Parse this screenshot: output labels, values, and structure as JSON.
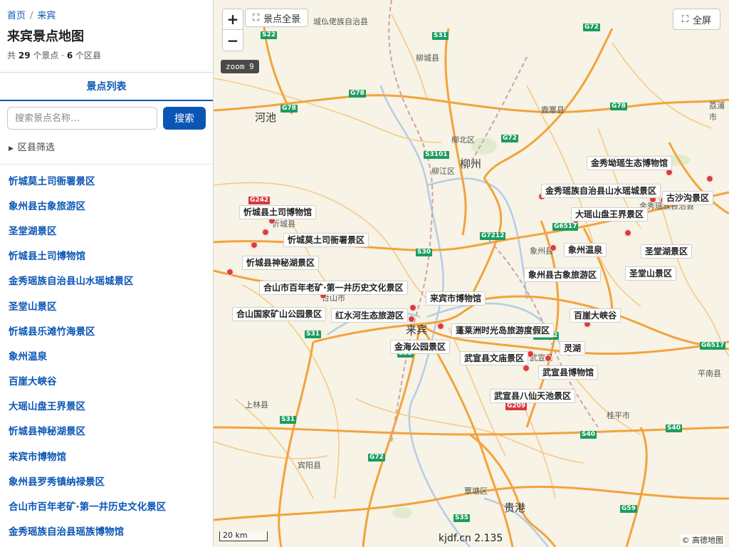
{
  "breadcrumb": {
    "home": "首页",
    "current": "来宾",
    "separator": "/"
  },
  "page": {
    "title": "来宾景点地图",
    "stats_prefix": "共",
    "spot_count": "29",
    "spot_unit": "个景点 ·",
    "district_count": "6",
    "district_unit": "个区县"
  },
  "tab": {
    "label": "景点列表"
  },
  "search": {
    "placeholder": "搜索景点名称…",
    "button": "搜索"
  },
  "filter": {
    "label": "区县筛选",
    "arrow": "▶"
  },
  "spots": [
    "忻城莫土司衙署景区",
    "象州县古象旅游区",
    "圣堂湖景区",
    "忻城县土司博物馆",
    "金秀瑶族自治县山水瑶城景区",
    "圣堂山景区",
    "忻城县乐滩竹海景区",
    "象州温泉",
    "百崖大峡谷",
    "大瑶山盘王界景区",
    "忻城县神秘湖景区",
    "来宾市博物馆",
    "象州县罗秀镇纳禄景区",
    "合山市百年老矿·第一井历史文化景区",
    "金秀瑶族自治县瑶族博物馆"
  ],
  "map": {
    "zoom_in": "+",
    "zoom_out": "−",
    "full_view": "景点全景",
    "full_view_icon": "⛶",
    "full_screen": "全屏",
    "full_screen_icon": "⛶",
    "zoom_label": "zoom 9",
    "scale": "20 km",
    "watermark": "kjdf.cn 2.135",
    "attribution": "© 高德地图",
    "colors": {
      "road_major": "#f2a33c",
      "road_minor": "#f6c98a",
      "rail": "#d8a0a8",
      "river": "#b5cde6",
      "pin": "#e03a3a",
      "link": "#0b56b5"
    },
    "labels": [
      "忻城县土司博物馆",
      "忻城莫土司衙署景区",
      "忻城县神秘湖景区",
      "合山市百年老矿·第一井历史文化景区",
      "合山国家矿山公园景区",
      "红水河生态旅游区",
      "来宾市博物馆",
      "蓬莱洲时光岛旅游度假区",
      "金海公园景区",
      "武宣县文庙景区",
      "灵湖",
      "武宣县博物馆",
      "武宣县八仙天池景区",
      "百崖大峡谷",
      "象州县古象旅游区",
      "象州温泉",
      "圣堂山景区",
      "圣堂湖景区",
      "大瑶山盘王界景区",
      "古沙沟景区",
      "金秀瑶族自治县山水瑶城景区",
      "金秀坳瑶生态博物馆"
    ],
    "cities": [
      "河池",
      "柳州",
      "来宾",
      "贵港"
    ],
    "towns": [
      "城仫佬族自治县",
      "柳城县",
      "鹿寨县",
      "柳北区",
      "柳江区",
      "象州县",
      "合山市",
      "武宣县",
      "上林县",
      "宾阳县",
      "桂平市",
      "覃塘区",
      "平南县",
      "金秀瑶族自治县",
      "荔浦市",
      "忻城县"
    ],
    "shields": [
      "S22",
      "S31",
      "G72",
      "G78",
      "G78",
      "G78",
      "S3101",
      "G72",
      "G242",
      "G7212",
      "G6517",
      "S30",
      "S31",
      "S52",
      "G7212",
      "G6517",
      "S31",
      "G209",
      "S40",
      "S40",
      "G72",
      "S35",
      "G59"
    ]
  }
}
